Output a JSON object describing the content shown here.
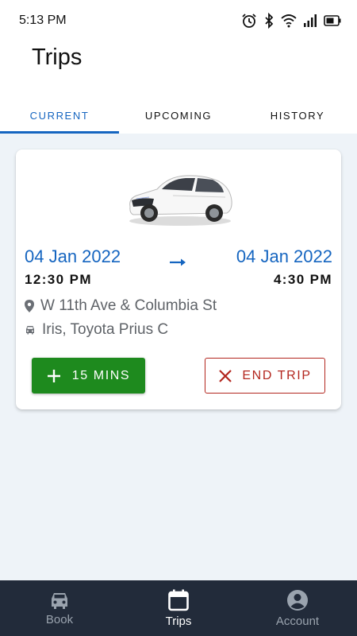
{
  "status_bar": {
    "time": "5:13 PM",
    "icons": [
      "alarm-icon",
      "bluetooth-icon",
      "wifi-icon",
      "signal-icon",
      "battery-icon"
    ]
  },
  "header": {
    "title": "Trips"
  },
  "tabs": [
    {
      "label": "CURRENT",
      "active": true
    },
    {
      "label": "UPCOMING",
      "active": false
    },
    {
      "label": "HISTORY",
      "active": false
    }
  ],
  "trip": {
    "start_date": "04 Jan 2022",
    "start_time": "12:30 PM",
    "end_date": "04 Jan 2022",
    "end_time": "4:30 PM",
    "location": "W 11th Ave & Columbia St",
    "vehicle": "Iris, Toyota Prius C",
    "extend_label": "15 MINS",
    "end_label": "END TRIP"
  },
  "bottom_nav": [
    {
      "label": "Book",
      "icon": "car-icon",
      "active": false
    },
    {
      "label": "Trips",
      "icon": "calendar-icon",
      "active": true
    },
    {
      "label": "Account",
      "icon": "account-icon",
      "active": false
    }
  ],
  "colors": {
    "accent": "#1565c0",
    "extend_button": "#1e8a1e",
    "end_button": "#b3261e",
    "nav_background": "#222b3a",
    "content_background": "#eef3f8"
  }
}
